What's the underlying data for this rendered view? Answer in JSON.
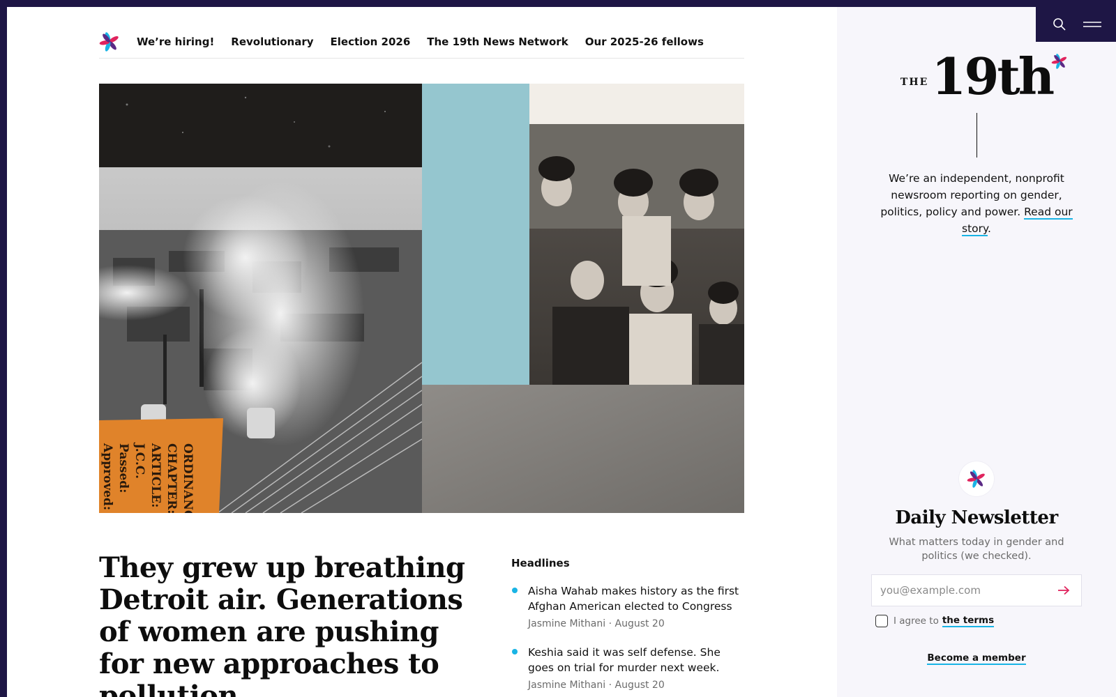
{
  "nav": {
    "logo_icon": "nineteenth-star-icon",
    "links": [
      {
        "label": "We’re hiring!"
      },
      {
        "label": "Revolutionary"
      },
      {
        "label": "Election 2026"
      },
      {
        "label": "The 19th News Network"
      },
      {
        "label": "Our 2025-26 fellows"
      }
    ]
  },
  "hero": {
    "ordinance_lines": [
      "ORDINANCE",
      "CHAPTER:",
      "ARTICLE:",
      "J.C.C.",
      "Passed:",
      "Approved:"
    ]
  },
  "article": {
    "headline": "They grew up breathing Detroit air. Generations of women are pushing for new approaches to pollution."
  },
  "headlines": {
    "title": "Headlines",
    "items": [
      {
        "text": "Aisha Wahab makes history as the first Afghan American elected to Congress",
        "meta": "Jasmine Mithani · August 20"
      },
      {
        "text": "Keshia said it was self defense. She goes on trial for murder next week.",
        "meta": "Jasmine Mithani · August 20"
      }
    ]
  },
  "tools": {
    "search_icon": "search-icon",
    "menu_icon": "menu-icon"
  },
  "brand": {
    "the": "THE",
    "name": "19th",
    "tagline": "We’re an independent, nonprofit newsroom reporting on gender, politics, policy and power.",
    "tagline_link": "Read our story",
    "tagline_end": "."
  },
  "newsletter": {
    "title": "Daily Newsletter",
    "description": "What matters today in gender and politics (we checked).",
    "email_placeholder": "you@example.com",
    "email_value": "",
    "terms_prefix": "I agree to",
    "terms_link": "the terms",
    "member_link": "Become a member"
  },
  "colors": {
    "frame": "#1e1645",
    "accent_cyan": "#19b4e5",
    "accent_magenta": "#e0245e",
    "accent_purple": "#5b2a86",
    "rail_bg": "#f7f6fb"
  }
}
